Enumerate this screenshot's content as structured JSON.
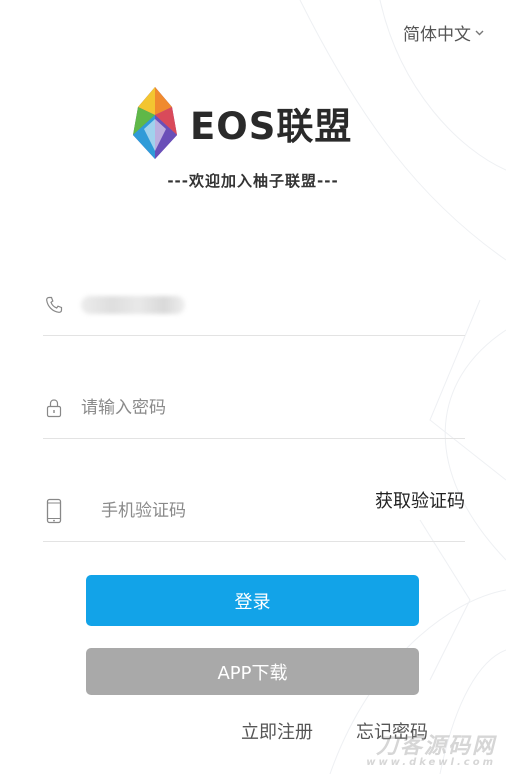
{
  "header": {
    "language": "简体中文",
    "language_icon": "chevron-down-icon"
  },
  "brand": {
    "logo_text": "EOS联盟",
    "tagline": "---欢迎加入柚子联盟---",
    "logo_icon": "crystal-gem-icon"
  },
  "form": {
    "phone": {
      "icon": "phone-icon",
      "value_redacted": true
    },
    "password": {
      "icon": "lock-icon",
      "placeholder": "请输入密码",
      "value": ""
    },
    "sms_code": {
      "icon": "mobile-phone-icon",
      "placeholder": "手机验证码",
      "value": "",
      "get_code_label": "获取验证码"
    }
  },
  "buttons": {
    "login_label": "登录",
    "app_download_label": "APP下载"
  },
  "links": {
    "register": "立即注册",
    "forgot_password": "忘记密码"
  },
  "watermark": {
    "main": "刀客源码网",
    "sub": "www.dkewl.com"
  },
  "colors": {
    "primary": "#12a3e8",
    "secondary_button": "#a9a9a9",
    "divider": "#e3e3e3",
    "placeholder": "#8a8a8a"
  }
}
